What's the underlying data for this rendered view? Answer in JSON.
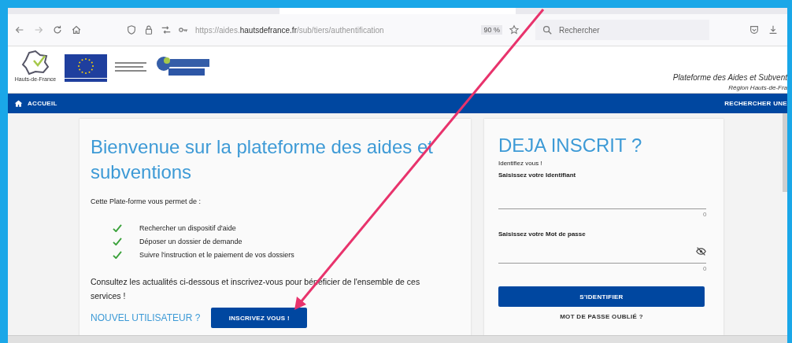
{
  "browser": {
    "url": "https://aides.**hautsdefrance.fr**/sub/tiers/authentification",
    "zoom": "90 %",
    "search_placeholder": "Rechercher"
  },
  "header": {
    "logo_caption": "Hauts-de-France",
    "title": "Plateforme des Aides et Subvent",
    "subtitle": "Région Hauts-de-Fra"
  },
  "nav": {
    "home": "ACCUEIL",
    "right": "RECHERCHER UNE"
  },
  "welcome": {
    "title": "Bienvenue sur la plateforme des aides et subventions",
    "intro": "Cette Plate-forme vous permet de :",
    "features": [
      "Rechercher un dispositif d'aide",
      "Déposer un dossier de demande",
      "Suivre l'instruction et le paiement de vos dossiers"
    ],
    "note": "Consultez les actualités ci-dessous et inscrivez-vous pour bénéficier de l'ensemble de ces services !",
    "new_user": "NOUVEL UTILISATEUR ?",
    "register_button": "INSCRIVEZ VOUS !"
  },
  "login": {
    "title": "DEJA INSCRIT ?",
    "subtitle": "Identifiez vous !",
    "fields": [
      {
        "label": "Saisissez votre Identifiant",
        "counter": "0",
        "kind": "text"
      },
      {
        "label": "Saisissez votre Mot de passe",
        "counter": "0",
        "kind": "password"
      }
    ],
    "submit": "S'IDENTIFIER",
    "forgot": "MOT DE PASSE OUBLIÉ ?"
  }
}
